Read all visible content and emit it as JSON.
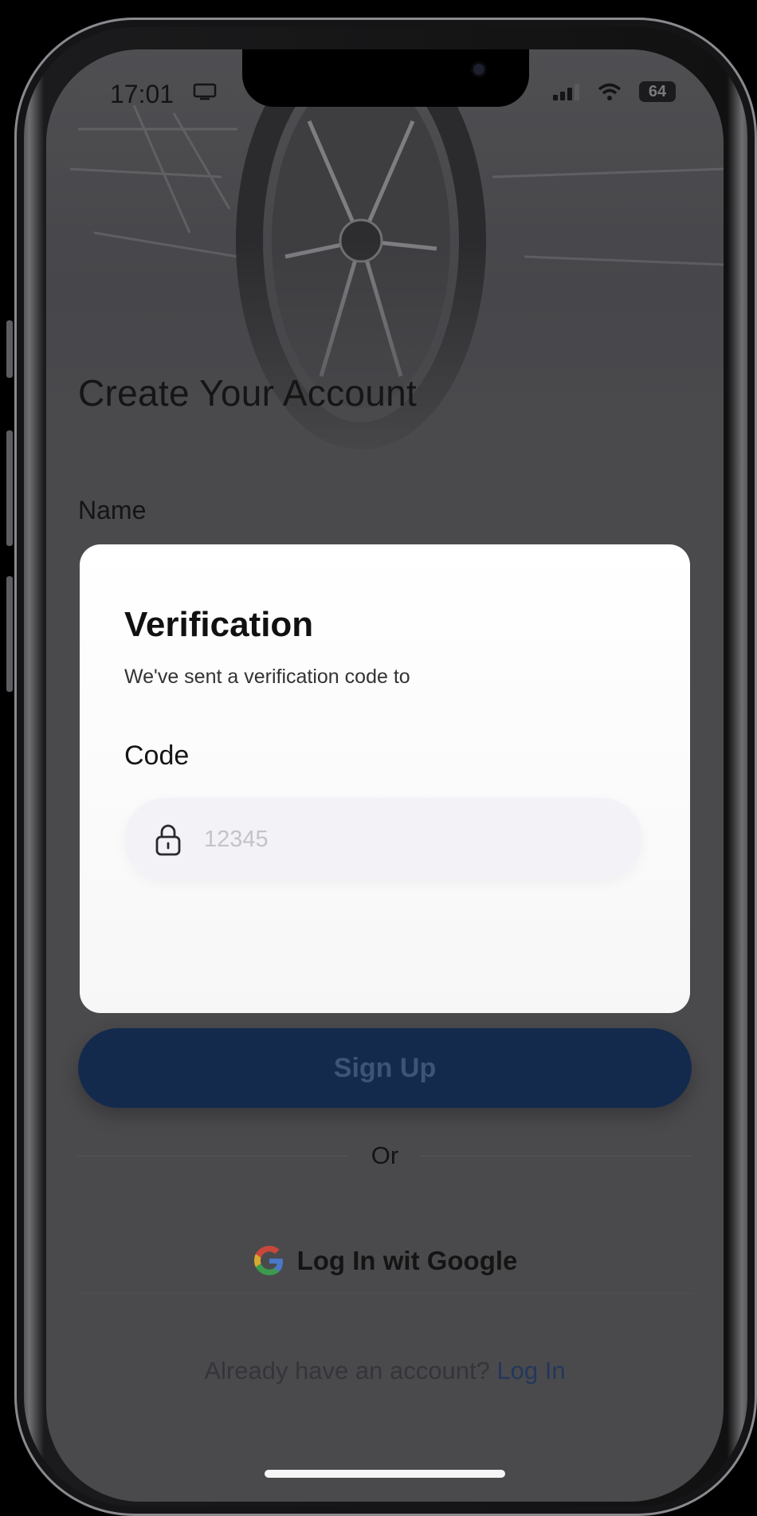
{
  "status_bar": {
    "time": "17:01",
    "battery": "64"
  },
  "page": {
    "title": "Create Your Account",
    "name_label": "Name"
  },
  "verification_modal": {
    "title": "Verification",
    "subtitle": "We've sent a verification code to",
    "code_label": "Code",
    "code_placeholder": "12345"
  },
  "actions": {
    "sign_up_label": "Sign Up",
    "or_label": "Or",
    "google_label": "Log In wit Google",
    "login_prompt": "Already have an account?",
    "login_link": "Log In"
  },
  "colors": {
    "primary_button": "#142a4d",
    "link": "#23375b",
    "overlay": "#4a4a4d"
  }
}
